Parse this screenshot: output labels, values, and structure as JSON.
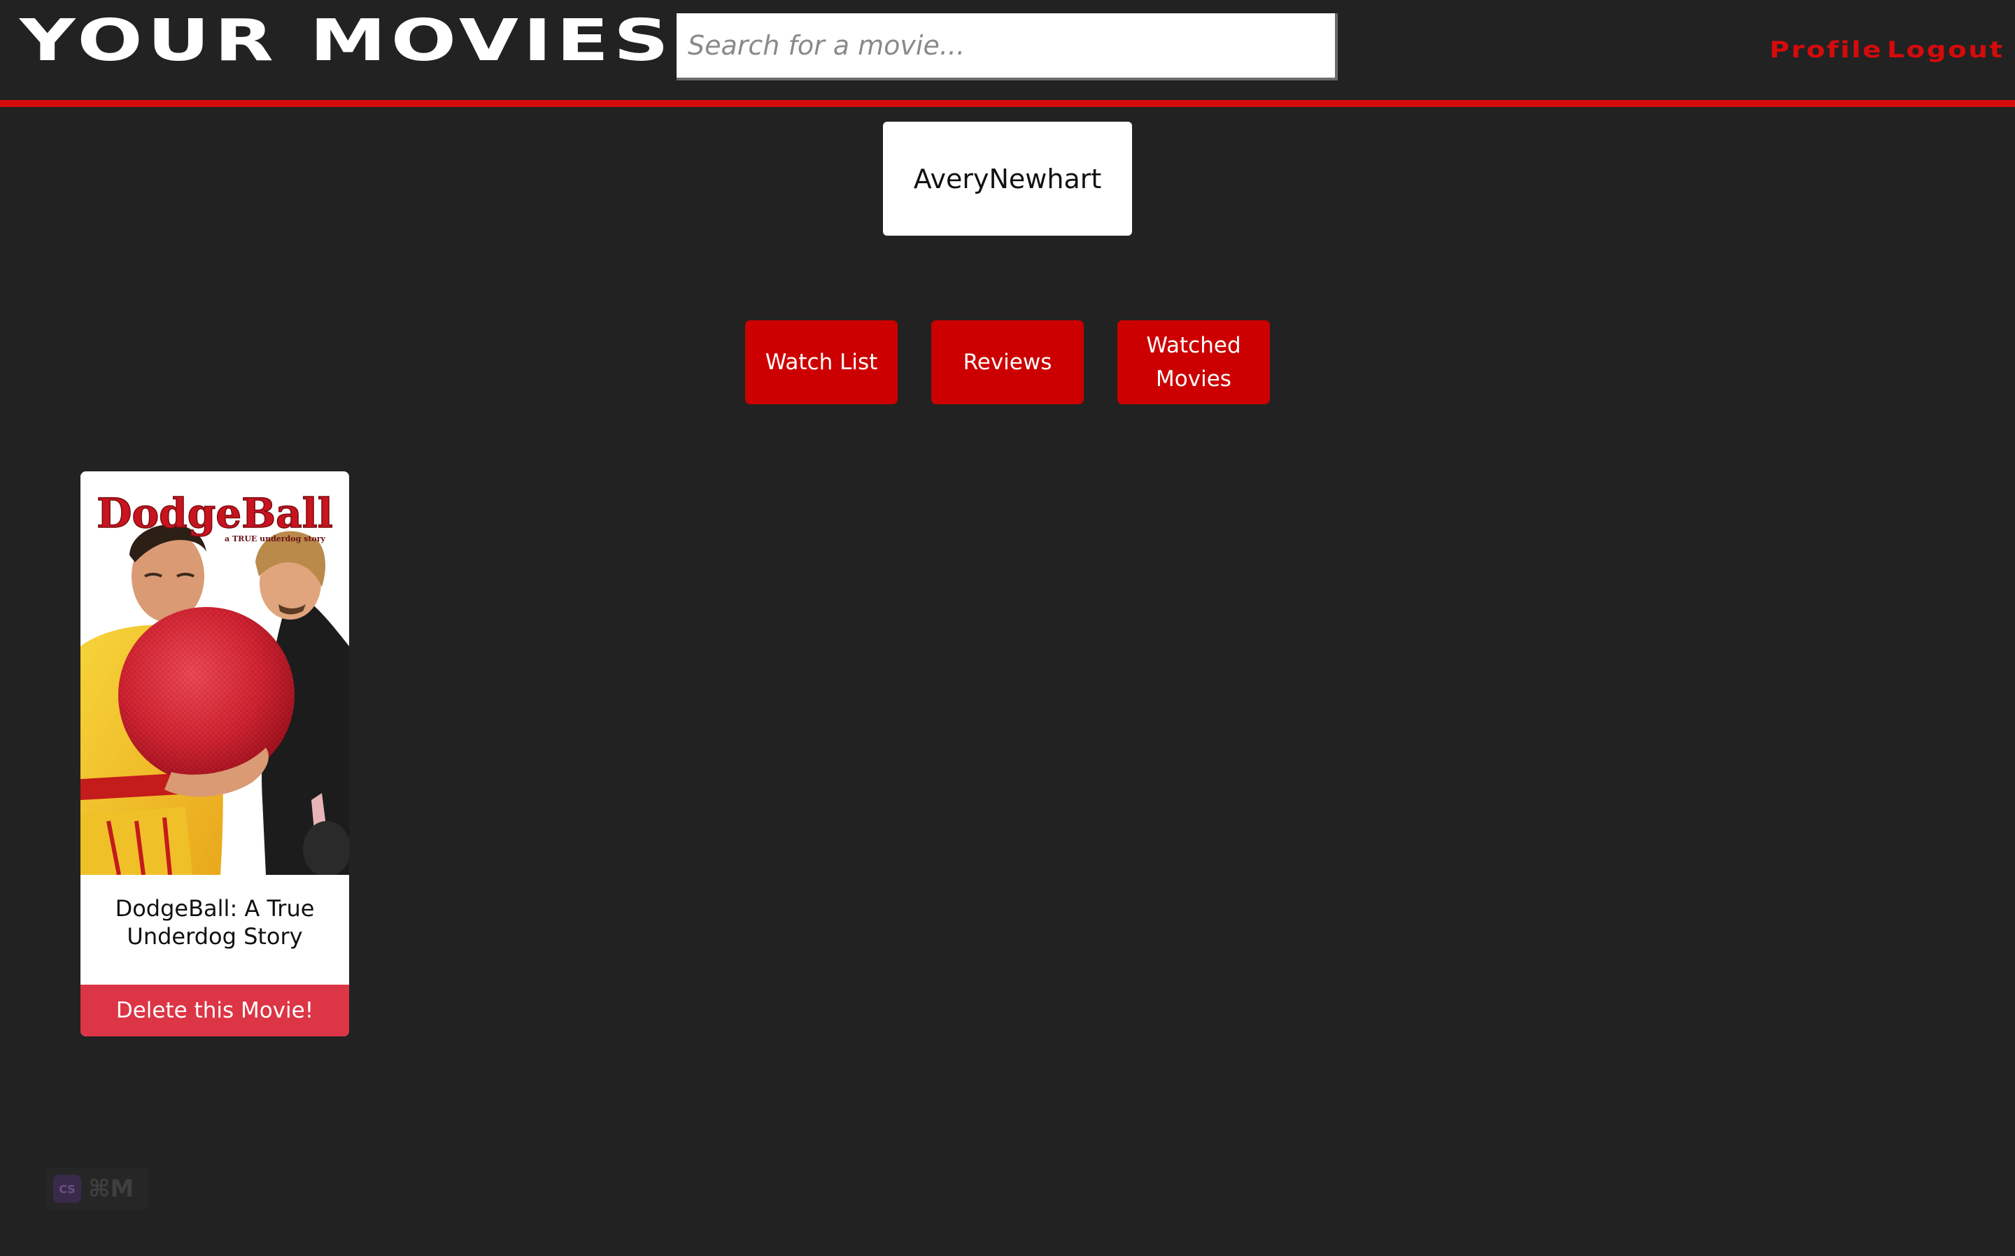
{
  "header": {
    "logo_text": "YOUR MOVIES",
    "search_placeholder": "Search for a movie...",
    "nav": {
      "profile_label": "Profile",
      "logout_label": "Logout"
    }
  },
  "profile": {
    "username": "AveryNewhart"
  },
  "tabs": {
    "watch_list_label": "Watch List",
    "reviews_label": "Reviews",
    "watched_movies_label": "Watched Movies"
  },
  "movies": [
    {
      "title": "DodgeBall: A True Underdog Story",
      "poster_title": "DodgeBall",
      "poster_tagline": "a TRUE underdog story",
      "delete_label": "Delete this Movie!"
    }
  ],
  "shortcut_badge": {
    "logo_text": "CS",
    "shortcut": "⌘M"
  },
  "colors": {
    "background": "#222222",
    "accent_red": "#d50b0b",
    "button_red": "#cc0000",
    "delete_red": "#dc3545"
  }
}
